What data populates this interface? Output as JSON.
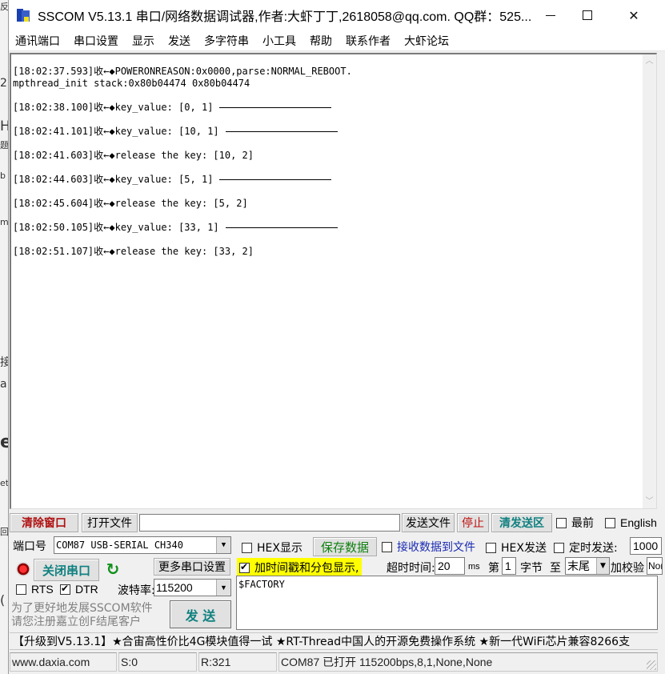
{
  "background_window": {
    "fragments": [
      "反",
      "2.",
      "H",
      "题",
      "b",
      "m",
      "接",
      "a",
      "e",
      "et",
      "回",
      "("
    ]
  },
  "titlebar": {
    "title": "SSCOM V5.13.1 串口/网络数据调试器,作者:大虾丁丁,2618058@qq.com. QQ群：525...",
    "minimize": "—",
    "maximize": "☐",
    "close": "✕"
  },
  "menu": {
    "items": [
      "通讯端口",
      "串口设置",
      "显示",
      "发送",
      "多字符串",
      "小工具",
      "帮助",
      "联系作者",
      "大虾论坛"
    ]
  },
  "receive": {
    "lines": [
      {
        "text": "[18:02:37.593]收←◆POWERONREASON:0x0000,parse:NORMAL_REBOOT.",
        "rule": false,
        "gap_before": false
      },
      {
        "text": "mpthread_init stack:0x80b04474 0x80b04474",
        "rule": false,
        "gap_before": false
      },
      {
        "text": "[18:02:38.100]收←◆key_value: [0, 1]",
        "rule": true,
        "gap_before": true
      },
      {
        "text": "[18:02:41.101]收←◆key_value: [10, 1]",
        "rule": true,
        "gap_before": true
      },
      {
        "text": "[18:02:41.603]收←◆release the key: [10, 2]",
        "rule": false,
        "gap_before": true
      },
      {
        "text": "[18:02:44.603]收←◆key_value: [5, 1]",
        "rule": true,
        "gap_before": true
      },
      {
        "text": "[18:02:45.604]收←◆release the key: [5, 2]",
        "rule": false,
        "gap_before": true
      },
      {
        "text": "[18:02:50.105]收←◆key_value: [33, 1]",
        "rule": true,
        "gap_before": true
      },
      {
        "text": "[18:02:51.107]收←◆release the key: [33, 2]",
        "rule": false,
        "gap_before": true
      }
    ],
    "scroll_up": "︿",
    "scroll_down": "﹀"
  },
  "toolbar": {
    "clear_window": "清除窗口",
    "open_file": "打开文件",
    "file_path": "",
    "send_file": "发送文件",
    "stop": "停止",
    "clear_send": "清发送区",
    "topmost_label": "最前",
    "topmost_checked": false,
    "english_label": "English",
    "english_checked": false
  },
  "port": {
    "port_label": "端口号",
    "port_value": "COM87 USB-SERIAL CH340",
    "close_port": "关闭串口",
    "more_settings": "更多串口设置",
    "rts_label": "RTS",
    "rts_checked": false,
    "dtr_label": "DTR",
    "dtr_checked": true,
    "baud_label": "波特率:",
    "baud_value": "115200",
    "promo_line1": "为了更好地发展SSCOM软件",
    "promo_line2": "请您注册嘉立创F结尾客户",
    "send_button": "发 送"
  },
  "display": {
    "hex_display_label": "HEX显示",
    "hex_display_checked": false,
    "save_data": "保存数据",
    "recv_to_file_label": "接收数据到文件",
    "recv_to_file_checked": false,
    "timestamp_label": "加时间戳和分包显示,",
    "timestamp_checked": true,
    "timeout_label": "超时时间:",
    "timeout_value": "20",
    "timeout_unit": "ms"
  },
  "send_options": {
    "hex_send_label": "HEX发送",
    "hex_send_checked": false,
    "timed_send_label": "定时发送:",
    "timed_send_checked": false,
    "timed_interval": "1000",
    "byte_from_label": "第",
    "byte_from_value": "1",
    "byte_unit": "字节",
    "to_label": "至",
    "to_value": "末尾",
    "checksum_label": "加校验",
    "checksum_value": "None"
  },
  "send_area": {
    "text": "$FACTORY"
  },
  "marquee": {
    "text": "【升级到V5.13.1】★合宙高性价比4G模块值得一试 ★RT-Thread中国人的开源免费操作系统 ★新一代WiFi芯片兼容8266支"
  },
  "statusbar": {
    "website": "www.daxia.com",
    "sent": "S:0",
    "received": "R:321",
    "port_status": "COM87 已打开  115200bps,8,1,None,None"
  }
}
